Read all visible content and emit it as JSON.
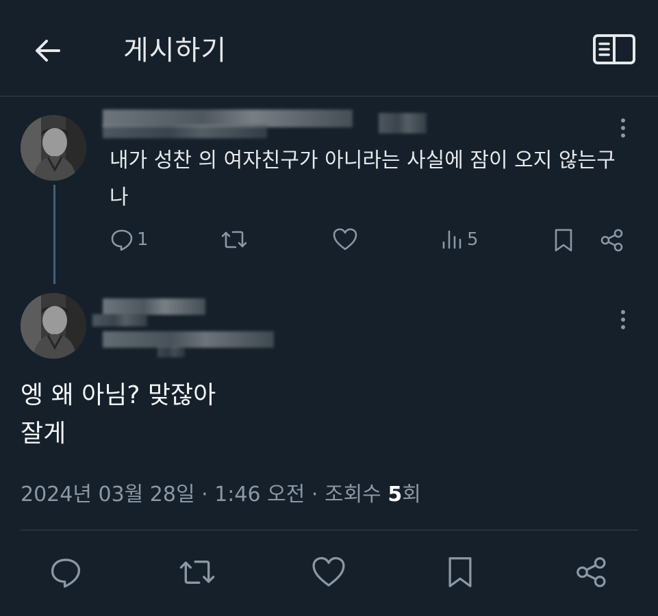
{
  "header": {
    "title": "게시하기",
    "back_icon": "arrow-left-icon",
    "reader_icon": "open-book-icon"
  },
  "reply_tweet": {
    "text": "내가 성찬 의 여자친구가 아니라는 사실에 잠이 오지 않는구나",
    "actions": {
      "reply_count": "1",
      "retweet_count": "",
      "like_count": "",
      "views_count": "5"
    }
  },
  "main_tweet": {
    "text_lines": [
      "엥 왜 아님? 맞잖아",
      "잘게"
    ],
    "meta": {
      "date": "2024년 03월 28일",
      "time": "1:46 오전",
      "views_label": "조회수",
      "views_count": "5",
      "views_suffix": "회",
      "separator": "·"
    }
  },
  "colors": {
    "background": "#15202b",
    "text": "#e7e9ea",
    "muted": "#8b98a5",
    "divider": "#38444d",
    "thread_line": "#42617a"
  }
}
